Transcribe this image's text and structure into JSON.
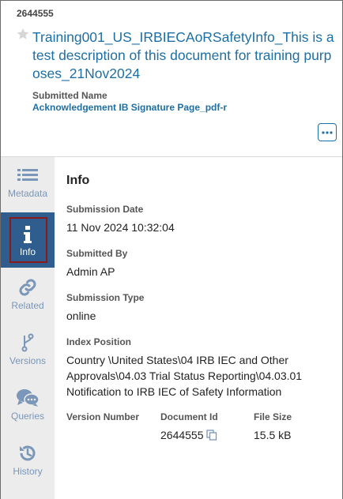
{
  "header": {
    "doc_id": "2644555",
    "title": "Training001_US_IRBIECAoRSafetyInfo_This is a test description of this document for training purposes_21Nov2024",
    "submitted_name_label": "Submitted Name",
    "submitted_name": "Acknowledgement IB Signature Page_pdf-r",
    "more_label": "•••"
  },
  "sidebar": {
    "items": [
      {
        "label": "Metadata",
        "icon": "list-icon"
      },
      {
        "label": "Info",
        "icon": "info-icon",
        "active": true
      },
      {
        "label": "Related",
        "icon": "link-icon"
      },
      {
        "label": "Versions",
        "icon": "branch-icon"
      },
      {
        "label": "Queries",
        "icon": "chat-icon"
      },
      {
        "label": "History",
        "icon": "history-icon"
      }
    ]
  },
  "info": {
    "title": "Info",
    "submission_date_label": "Submission Date",
    "submission_date": "11 Nov 2024 10:32:04",
    "submitted_by_label": "Submitted By",
    "submitted_by": "Admin AP",
    "submission_type_label": "Submission Type",
    "submission_type": "online",
    "index_position_label": "Index Position",
    "index_position": "Country \\United States\\04 IRB IEC and Other Approvals\\04.03 Trial Status Reporting\\04.03.01 Notification to IRB IEC of Safety Information",
    "version_number_label": "Version Number",
    "document_id_label": "Document Id",
    "document_id": "2644555",
    "file_size_label": "File Size",
    "file_size": "15.5 kB"
  },
  "colors": {
    "link_blue": "#1d6fa5",
    "sidebar_bg": "#ececec",
    "active_bg": "#2f5d8e",
    "icon_blue": "#7a96b8",
    "focus_border": "#8b1a1a"
  }
}
